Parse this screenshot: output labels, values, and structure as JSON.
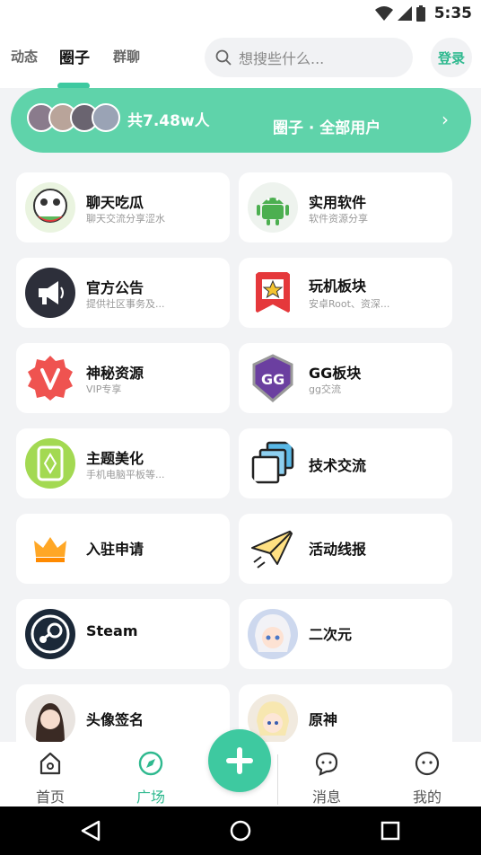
{
  "status_bar": {
    "time": "5:35"
  },
  "header": {
    "tabs": [
      {
        "label": "动态",
        "active": false
      },
      {
        "label": "圈子",
        "active": true
      },
      {
        "label": "群聊",
        "active": false
      }
    ],
    "search_placeholder": "想搜些什么...",
    "login_label": "登录"
  },
  "banner": {
    "member_count": "共7.48w人",
    "title": "圈子 · 全部用户",
    "chevron": "›"
  },
  "circles": [
    {
      "name": "聊天吃瓜",
      "desc": "聊天交流分享涩水",
      "icon": "panda-meme-icon"
    },
    {
      "name": "实用软件",
      "desc": "软件资源分享",
      "icon": "android-icon"
    },
    {
      "name": "官方公告",
      "desc": "提供社区事务及...",
      "icon": "megaphone-icon"
    },
    {
      "name": "玩机板块",
      "desc": "安卓Root、资深...",
      "icon": "star-badge-icon"
    },
    {
      "name": "神秘资源",
      "desc": "VIP专享",
      "icon": "vip-badge-icon"
    },
    {
      "name": "GG板块",
      "desc": "gg交流",
      "icon": "gg-shield-icon"
    },
    {
      "name": "主题美化",
      "desc": "手机电脑平板等...",
      "icon": "phone-theme-icon"
    },
    {
      "name": "技术交流",
      "desc": "",
      "icon": "stacked-windows-icon"
    },
    {
      "name": "入驻申请",
      "desc": "",
      "icon": "crown-icon"
    },
    {
      "name": "活动线报",
      "desc": "",
      "icon": "paper-plane-icon"
    },
    {
      "name": "Steam",
      "desc": "",
      "icon": "steam-icon"
    },
    {
      "name": "二次元",
      "desc": "",
      "icon": "anime-avatar-icon"
    },
    {
      "name": "头像签名",
      "desc": "",
      "icon": "portrait-avatar-icon"
    },
    {
      "name": "原神",
      "desc": "",
      "icon": "genshin-avatar-icon"
    }
  ],
  "bottom_nav": [
    {
      "label": "首页",
      "icon": "home-icon",
      "active": false
    },
    {
      "label": "广场",
      "icon": "compass-icon",
      "active": true
    },
    {
      "label": "消息",
      "icon": "chat-icon",
      "active": false
    },
    {
      "label": "我的",
      "icon": "face-icon",
      "active": false
    }
  ],
  "colors": {
    "accent": "#3ec9a0",
    "banner": "#5fd3aa",
    "background": "#f2f3f5"
  }
}
